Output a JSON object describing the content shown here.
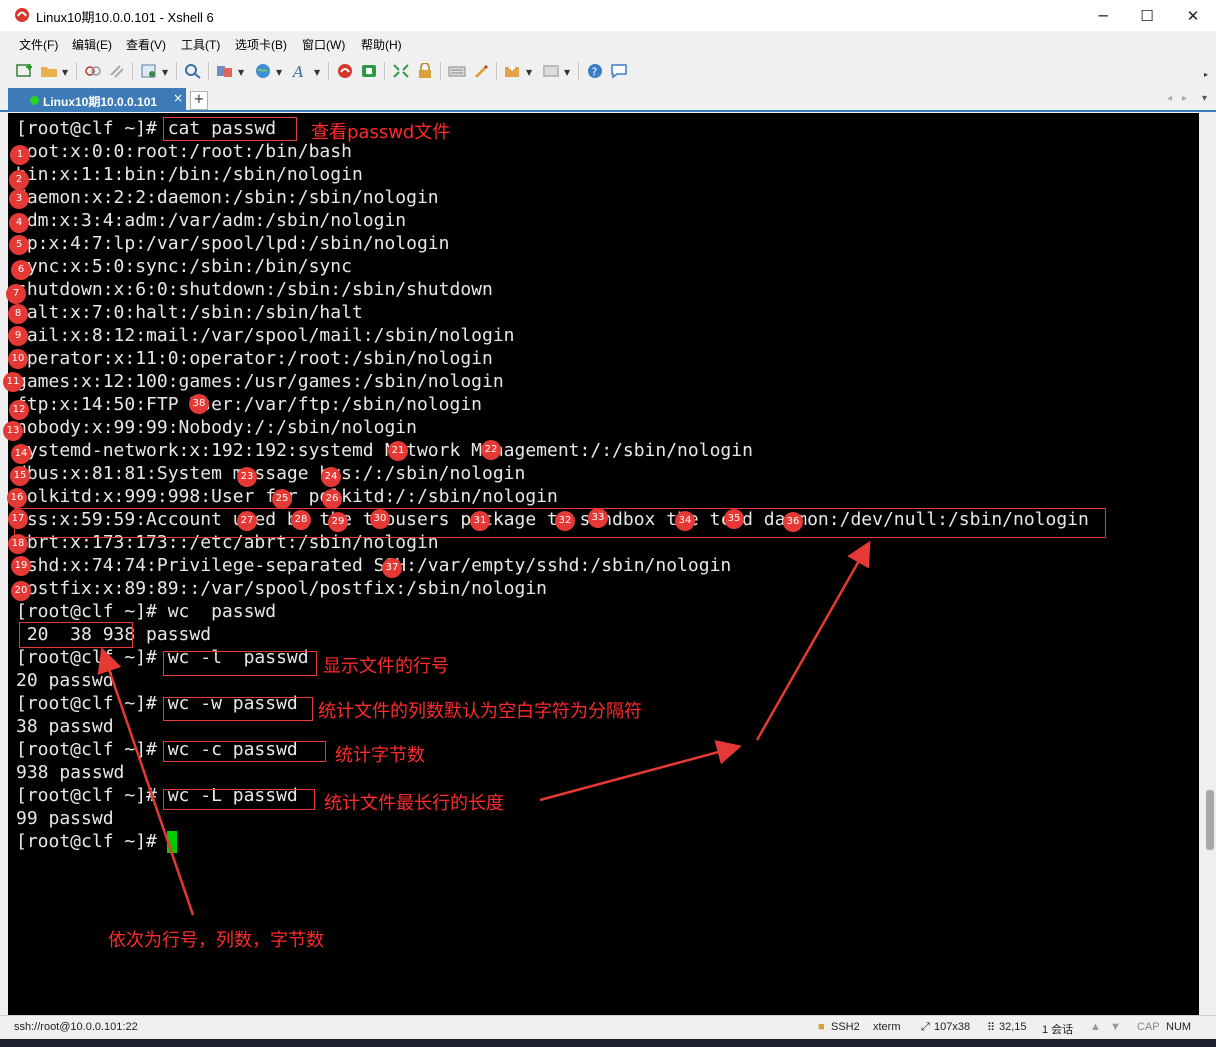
{
  "window": {
    "title": "Linux10期10.0.0.101 - Xshell 6",
    "minimize_glyph": "─",
    "maximize_glyph": "☐",
    "close_glyph": "✕"
  },
  "menu": [
    "文件(F)",
    "编辑(E)",
    "查看(V)",
    "工具(T)",
    "选项卡(B)",
    "窗口(W)",
    "帮助(H)"
  ],
  "toolbar_icons": [
    "new-session-icon",
    "open-folder-icon",
    "disconnect-icon",
    "reconnect-icon",
    "properties-icon",
    "find-icon",
    "transfer-icon",
    "globe-icon",
    "font-icon",
    "xftp-icon",
    "xmanager-icon",
    "fullscreen-icon",
    "lock-icon",
    "keyboard-icon",
    "highlight-icon",
    "compose-icon",
    "layout-icon",
    "help-icon",
    "chat-icon"
  ],
  "tab": {
    "label": "Linux10期10.0.0.101",
    "close": "×",
    "add": "+"
  },
  "terminal": {
    "lines": [
      "[root@clf ~]# cat passwd",
      "root:x:0:0:root:/root:/bin/bash",
      "bin:x:1:1:bin:/bin:/sbin/nologin",
      "daemon:x:2:2:daemon:/sbin:/sbin/nologin",
      "adm:x:3:4:adm:/var/adm:/sbin/nologin",
      "lp:x:4:7:lp:/var/spool/lpd:/sbin/nologin",
      "sync:x:5:0:sync:/sbin:/bin/sync",
      "shutdown:x:6:0:shutdown:/sbin:/sbin/shutdown",
      "halt:x:7:0:halt:/sbin:/sbin/halt",
      "mail:x:8:12:mail:/var/spool/mail:/sbin/nologin",
      "operator:x:11:0:operator:/root:/sbin/nologin",
      "games:x:12:100:games:/usr/games:/sbin/nologin",
      "ftp:x:14:50:FTP User:/var/ftp:/sbin/nologin",
      "nobody:x:99:99:Nobody:/:/sbin/nologin",
      "systemd-network:x:192:192:systemd Network Management:/:/sbin/nologin",
      "dbus:x:81:81:System message bus:/:/sbin/nologin",
      "polkitd:x:999:998:User for polkitd:/:/sbin/nologin",
      "tss:x:59:59:Account used by the trousers package to sandbox the tcsd daemon:/dev/null:/sbin/nologin",
      "abrt:x:173:173::/etc/abrt:/sbin/nologin",
      "sshd:x:74:74:Privilege-separated SSH:/var/empty/sshd:/sbin/nologin",
      "postfix:x:89:89::/var/spool/postfix:/sbin/nologin",
      "[root@clf ~]# wc  passwd",
      " 20  38 938 passwd",
      "[root@clf ~]# wc -l  passwd",
      "20 passwd",
      "[root@clf ~]# wc -w passwd",
      "38 passwd",
      "[root@clf ~]# wc -c passwd",
      "938 passwd",
      "[root@clf ~]# wc -L passwd",
      "99 passwd",
      "[root@clf ~]# "
    ]
  },
  "annotations": {
    "cat_note": "查看passwd文件",
    "wc_l_note": "显示文件的行号",
    "wc_w_note": "统计文件的列数默认为空白字符为分隔符",
    "wc_c_note": "统计字节数",
    "wc_L_note": "统计文件最长行的长度",
    "order_note": "依次为行号，列数，字节数",
    "markers": [
      "1",
      "2",
      "3",
      "4",
      "5",
      "6",
      "7",
      "8",
      "9",
      "10",
      "11",
      "12",
      "13",
      "14",
      "15",
      "16",
      "17",
      "18",
      "19",
      "20",
      "21",
      "22",
      "23",
      "24",
      "25",
      "26",
      "27",
      "28",
      "29",
      "30",
      "31",
      "32",
      "33",
      "34",
      "35",
      "36",
      "37",
      "38"
    ]
  },
  "status": {
    "connection": "ssh://root@10.0.0.101:22",
    "protocol": "SSH2",
    "term": "xterm",
    "size": "107x38",
    "pos": "32,15",
    "sessions": "1 会话",
    "cap": "CAP",
    "num": "NUM"
  },
  "colors": {
    "annotation": "#e53935",
    "tab_active": "#3d7ab8",
    "cursor": "#00cc00"
  }
}
